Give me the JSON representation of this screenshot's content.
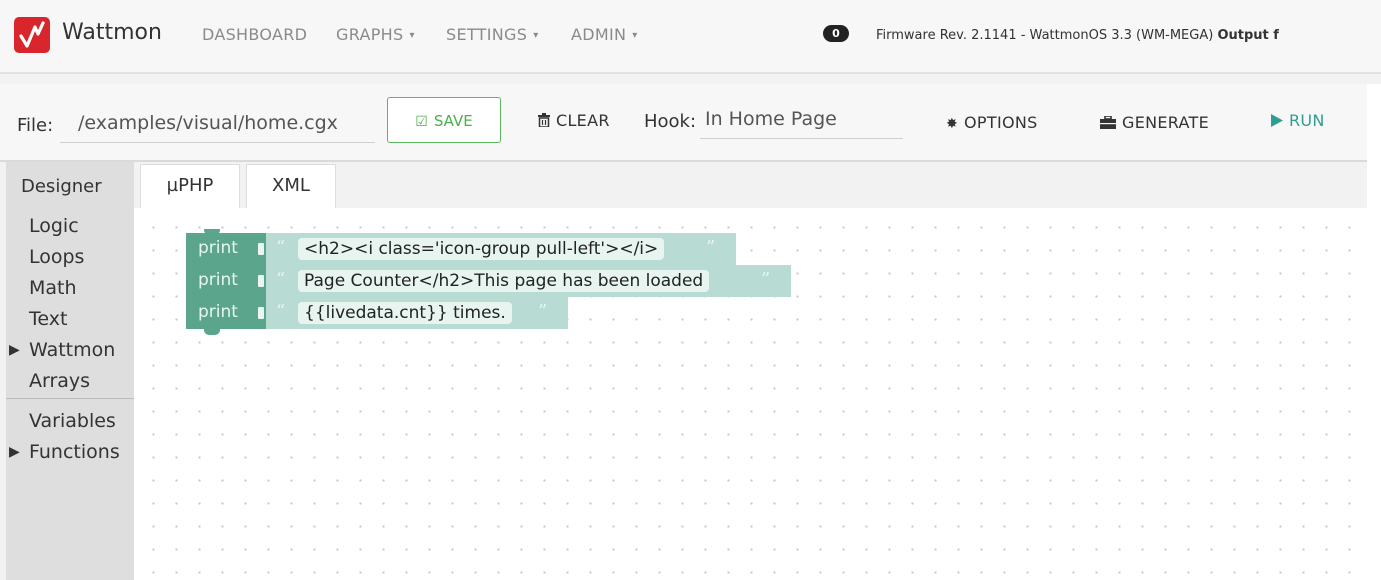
{
  "navbar": {
    "brand": "Wattmon",
    "items": [
      {
        "label": "DASHBOARD",
        "caret": ""
      },
      {
        "label": "GRAPHS",
        "caret": "▾"
      },
      {
        "label": "SETTINGS",
        "caret": "▾"
      },
      {
        "label": "ADMIN",
        "caret": "▾"
      }
    ],
    "badge_count": "0",
    "firmware_text": "Firmware Rev. 2.1141 - WattmonOS 3.3 (WM-MEGA) ",
    "firmware_bold": "Output f"
  },
  "toolbar": {
    "file_label": "File:",
    "file_value": "/examples/visual/home.cgx",
    "save_label": "SAVE",
    "clear_label": "CLEAR",
    "hook_label": "Hook:",
    "hook_value": "In Home Page",
    "options_label": "OPTIONS",
    "generate_label": "GENERATE",
    "run_label": "RUN",
    "icons": {
      "save": "check-square-icon",
      "clear": "trash-icon",
      "options": "gear-icon",
      "generate": "briefcase-icon",
      "run": "play-icon"
    }
  },
  "sidebar": {
    "title": "Designer",
    "categories": [
      {
        "label": "Logic",
        "expandable": false
      },
      {
        "label": "Loops",
        "expandable": false
      },
      {
        "label": "Math",
        "expandable": false
      },
      {
        "label": "Text",
        "expandable": false
      },
      {
        "label": "Wattmon",
        "expandable": true
      },
      {
        "label": "Arrays",
        "expandable": false
      },
      {
        "label": "Variables",
        "expandable": false
      },
      {
        "label": "Functions",
        "expandable": true
      }
    ]
  },
  "tabs": [
    {
      "label": "µPHP"
    },
    {
      "label": "XML"
    }
  ],
  "blocks": [
    {
      "keyword": "print",
      "open_quote": "“",
      "text": "<h2><i class='icon-group pull-left'></i>",
      "close_quote": "”"
    },
    {
      "keyword": "print",
      "open_quote": "“",
      "text": "Page Counter</h2>This page has been loaded ",
      "close_quote": "”"
    },
    {
      "keyword": "print",
      "open_quote": "“",
      "text": "{{livedata.cnt}} times.",
      "close_quote": "”"
    }
  ],
  "colors": {
    "brand_red": "#d9262c",
    "block_dark": "#5ba58c",
    "block_light": "#b8dcd3",
    "save_green": "#5cb85c",
    "run_teal": "#2f9d8f"
  }
}
